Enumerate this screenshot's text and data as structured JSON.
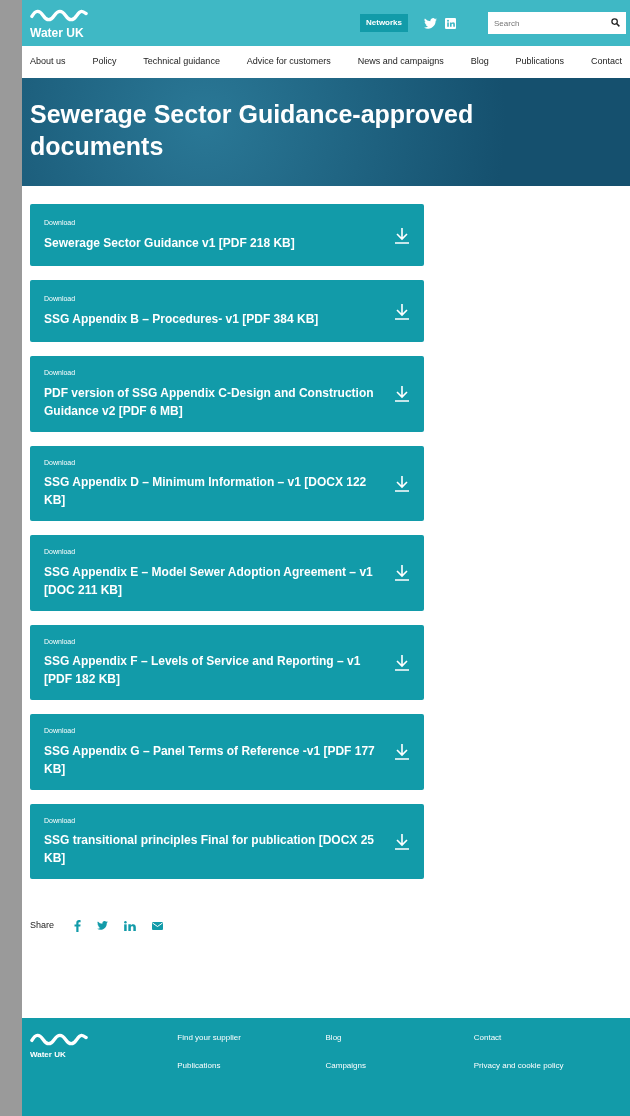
{
  "header": {
    "logo_text": "Water UK",
    "networks_button": "Networks",
    "search": {
      "placeholder": "Search"
    }
  },
  "nav": [
    "About us",
    "Policy",
    "Technical guidance",
    "Advice for customers",
    "News and campaigns",
    "Blog",
    "Publications",
    "Contact"
  ],
  "hero": {
    "title": "Sewerage Sector Guidance-approved documents"
  },
  "downloads": [
    {
      "label": "Download",
      "title": "Sewerage Sector Guidance v1 [PDF 218 KB]"
    },
    {
      "label": "Download",
      "title": "SSG Appendix B – Procedures- v1 [PDF 384 KB]"
    },
    {
      "label": "Download",
      "title": "PDF version of SSG Appendix C-Design and Construction Guidance v2 [PDF 6 MB]"
    },
    {
      "label": "Download",
      "title": "SSG Appendix D – Minimum Information – v1 [DOCX 122 KB]"
    },
    {
      "label": "Download",
      "title": "SSG Appendix E – Model Sewer Adoption Agreement – v1 [DOC 211 KB]"
    },
    {
      "label": "Download",
      "title": "SSG Appendix F – Levels of Service and Reporting – v1 [PDF 182 KB]"
    },
    {
      "label": "Download",
      "title": "SSG Appendix G – Panel Terms of Reference -v1 [PDF 177 KB]"
    },
    {
      "label": "Download",
      "title": "SSG transitional principles Final for publication [DOCX 25 KB]"
    }
  ],
  "share": {
    "label": "Share"
  },
  "footer": {
    "logo_text": "Water UK",
    "links": [
      [
        "Find your supplier",
        "Publications"
      ],
      [
        "Blog",
        "Campaigns"
      ],
      [
        "Contact",
        "Privacy and cookie policy"
      ]
    ]
  }
}
